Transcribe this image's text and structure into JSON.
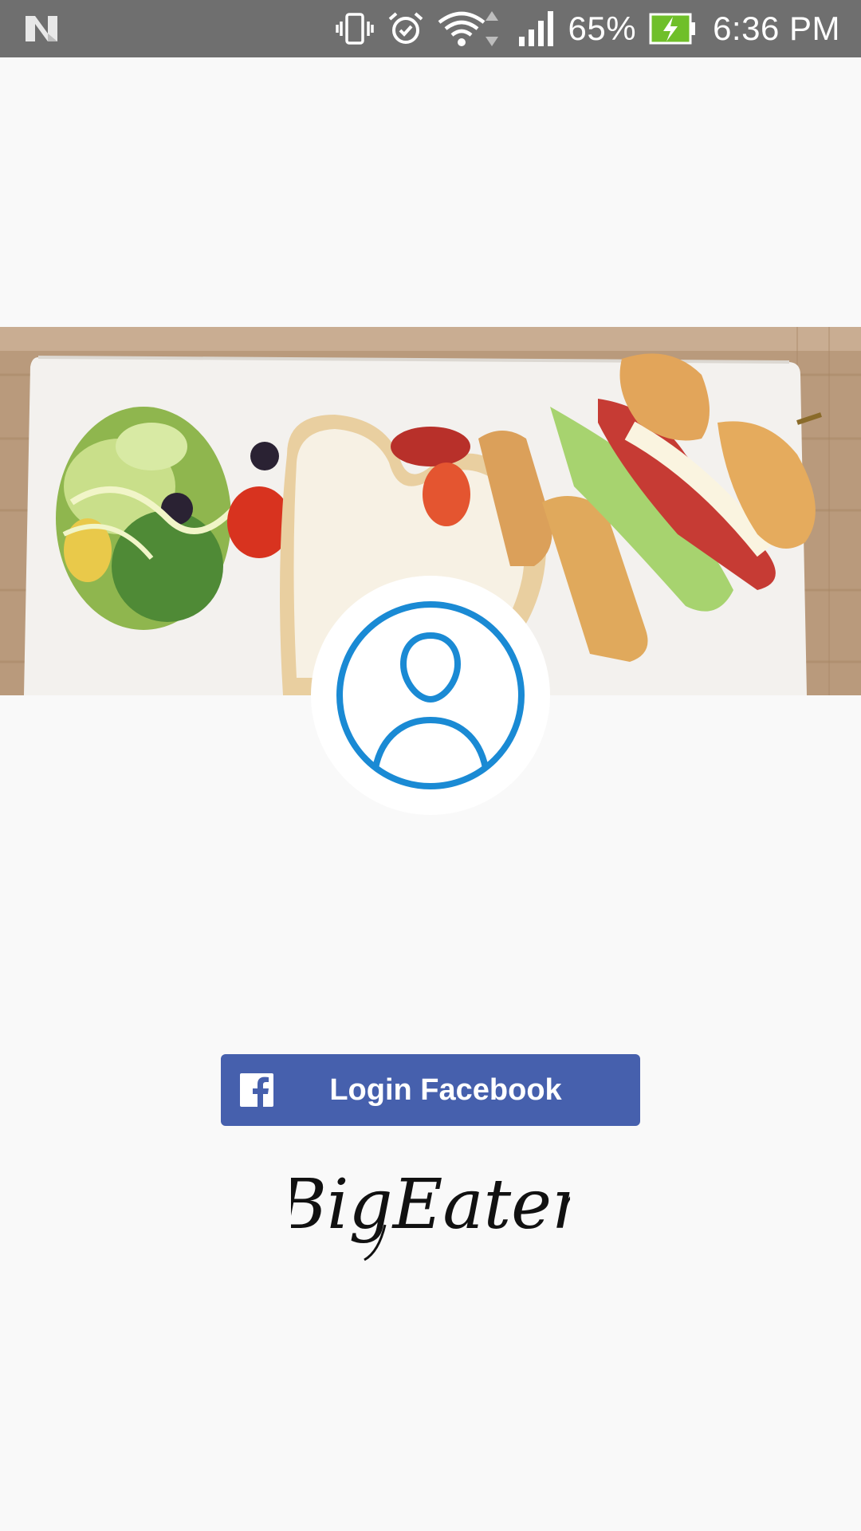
{
  "status_bar": {
    "battery_percent": "65%",
    "time": "6:36 PM",
    "icons": [
      "n-logo-icon",
      "vibrate-icon",
      "alarm-icon",
      "wifi-icon",
      "signal-icon",
      "battery-charging-icon"
    ],
    "background": "#6f6f6f"
  },
  "cover": {
    "description_icon": "food-photo"
  },
  "avatar": {
    "icon": "user-icon",
    "accent": "#1a8ad4"
  },
  "login": {
    "button_label": "Login Facebook",
    "icon": "facebook-icon",
    "background": "#4660ad"
  },
  "brand": {
    "name": "BigEater"
  }
}
